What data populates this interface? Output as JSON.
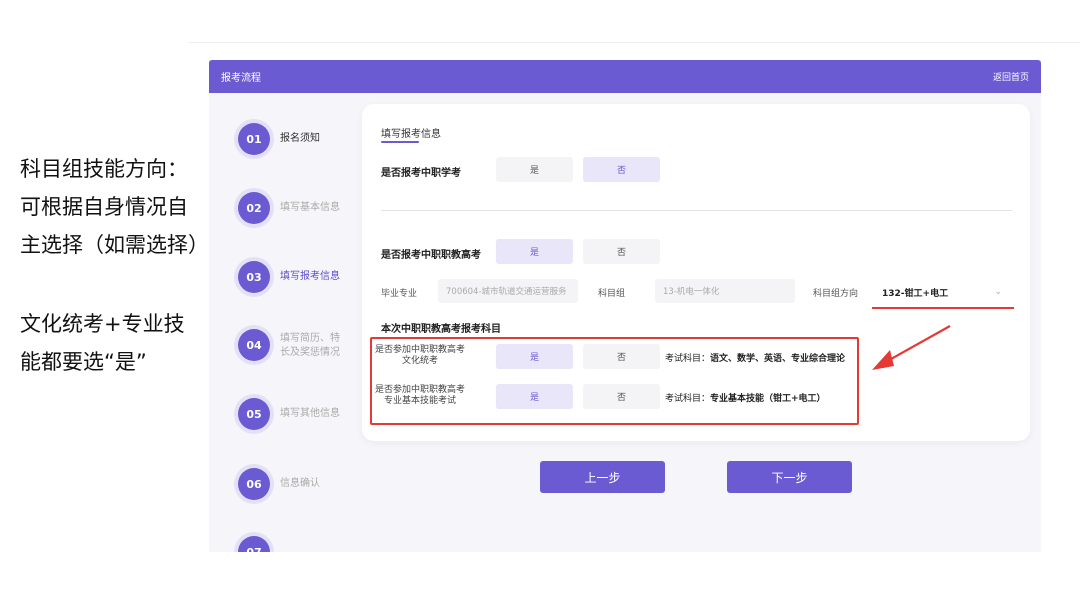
{
  "annotations": {
    "block1": [
      "科目组技能方向：",
      "可根据自身情况自",
      "主选择（如需选择）"
    ],
    "block2": [
      "文化统考+专业技",
      "能都要选“是”"
    ]
  },
  "header": {
    "title": "报考流程",
    "back_link": "返回首页"
  },
  "steps": [
    {
      "num": "01",
      "label": "报名须知",
      "state": "done"
    },
    {
      "num": "02",
      "label": "填写基本信息",
      "state": "todo"
    },
    {
      "num": "03",
      "label": "填写报考信息",
      "state": "active"
    },
    {
      "num": "04",
      "label": "填写简历、特长及奖惩情况",
      "state": "todo"
    },
    {
      "num": "05",
      "label": "填写其他信息",
      "state": "todo"
    },
    {
      "num": "06",
      "label": "信息确认",
      "state": "todo"
    },
    {
      "num": "07",
      "label": "",
      "state": "todo"
    }
  ],
  "form": {
    "card_title": "填写报考信息",
    "q1": {
      "label": "是否报考中职学考",
      "yes": "是",
      "no": "否",
      "selected": "no"
    },
    "q2": {
      "label": "是否报考中职职教高考",
      "yes": "是",
      "no": "否",
      "selected": "yes"
    },
    "fields": {
      "major_label": "毕业专业",
      "major_value": "700604-城市轨道交通运营服务",
      "group_label": "科目组",
      "group_value": "13-机电一体化",
      "direction_label": "科目组方向",
      "direction_value": "132-钳工+电工"
    },
    "subjects_title": "本次中职职教高考报考科目",
    "subj1": {
      "label_line1": "是否参加中职职教高考",
      "label_line2": "文化统考",
      "yes": "是",
      "no": "否",
      "selected": "yes",
      "note_prefix": "考试科目：",
      "note_value": "语文、数学、英语、专业综合理论"
    },
    "subj2": {
      "label_line1": "是否参加中职职教高考",
      "label_line2": "专业基本技能考试",
      "yes": "是",
      "no": "否",
      "selected": "yes",
      "note_prefix": "考试科目：",
      "note_value": "专业基本技能（钳工+电工）"
    }
  },
  "nav": {
    "prev": "上一步",
    "next": "下一步"
  },
  "colors": {
    "accent": "#6b5bd3",
    "highlight": "#e53935"
  }
}
